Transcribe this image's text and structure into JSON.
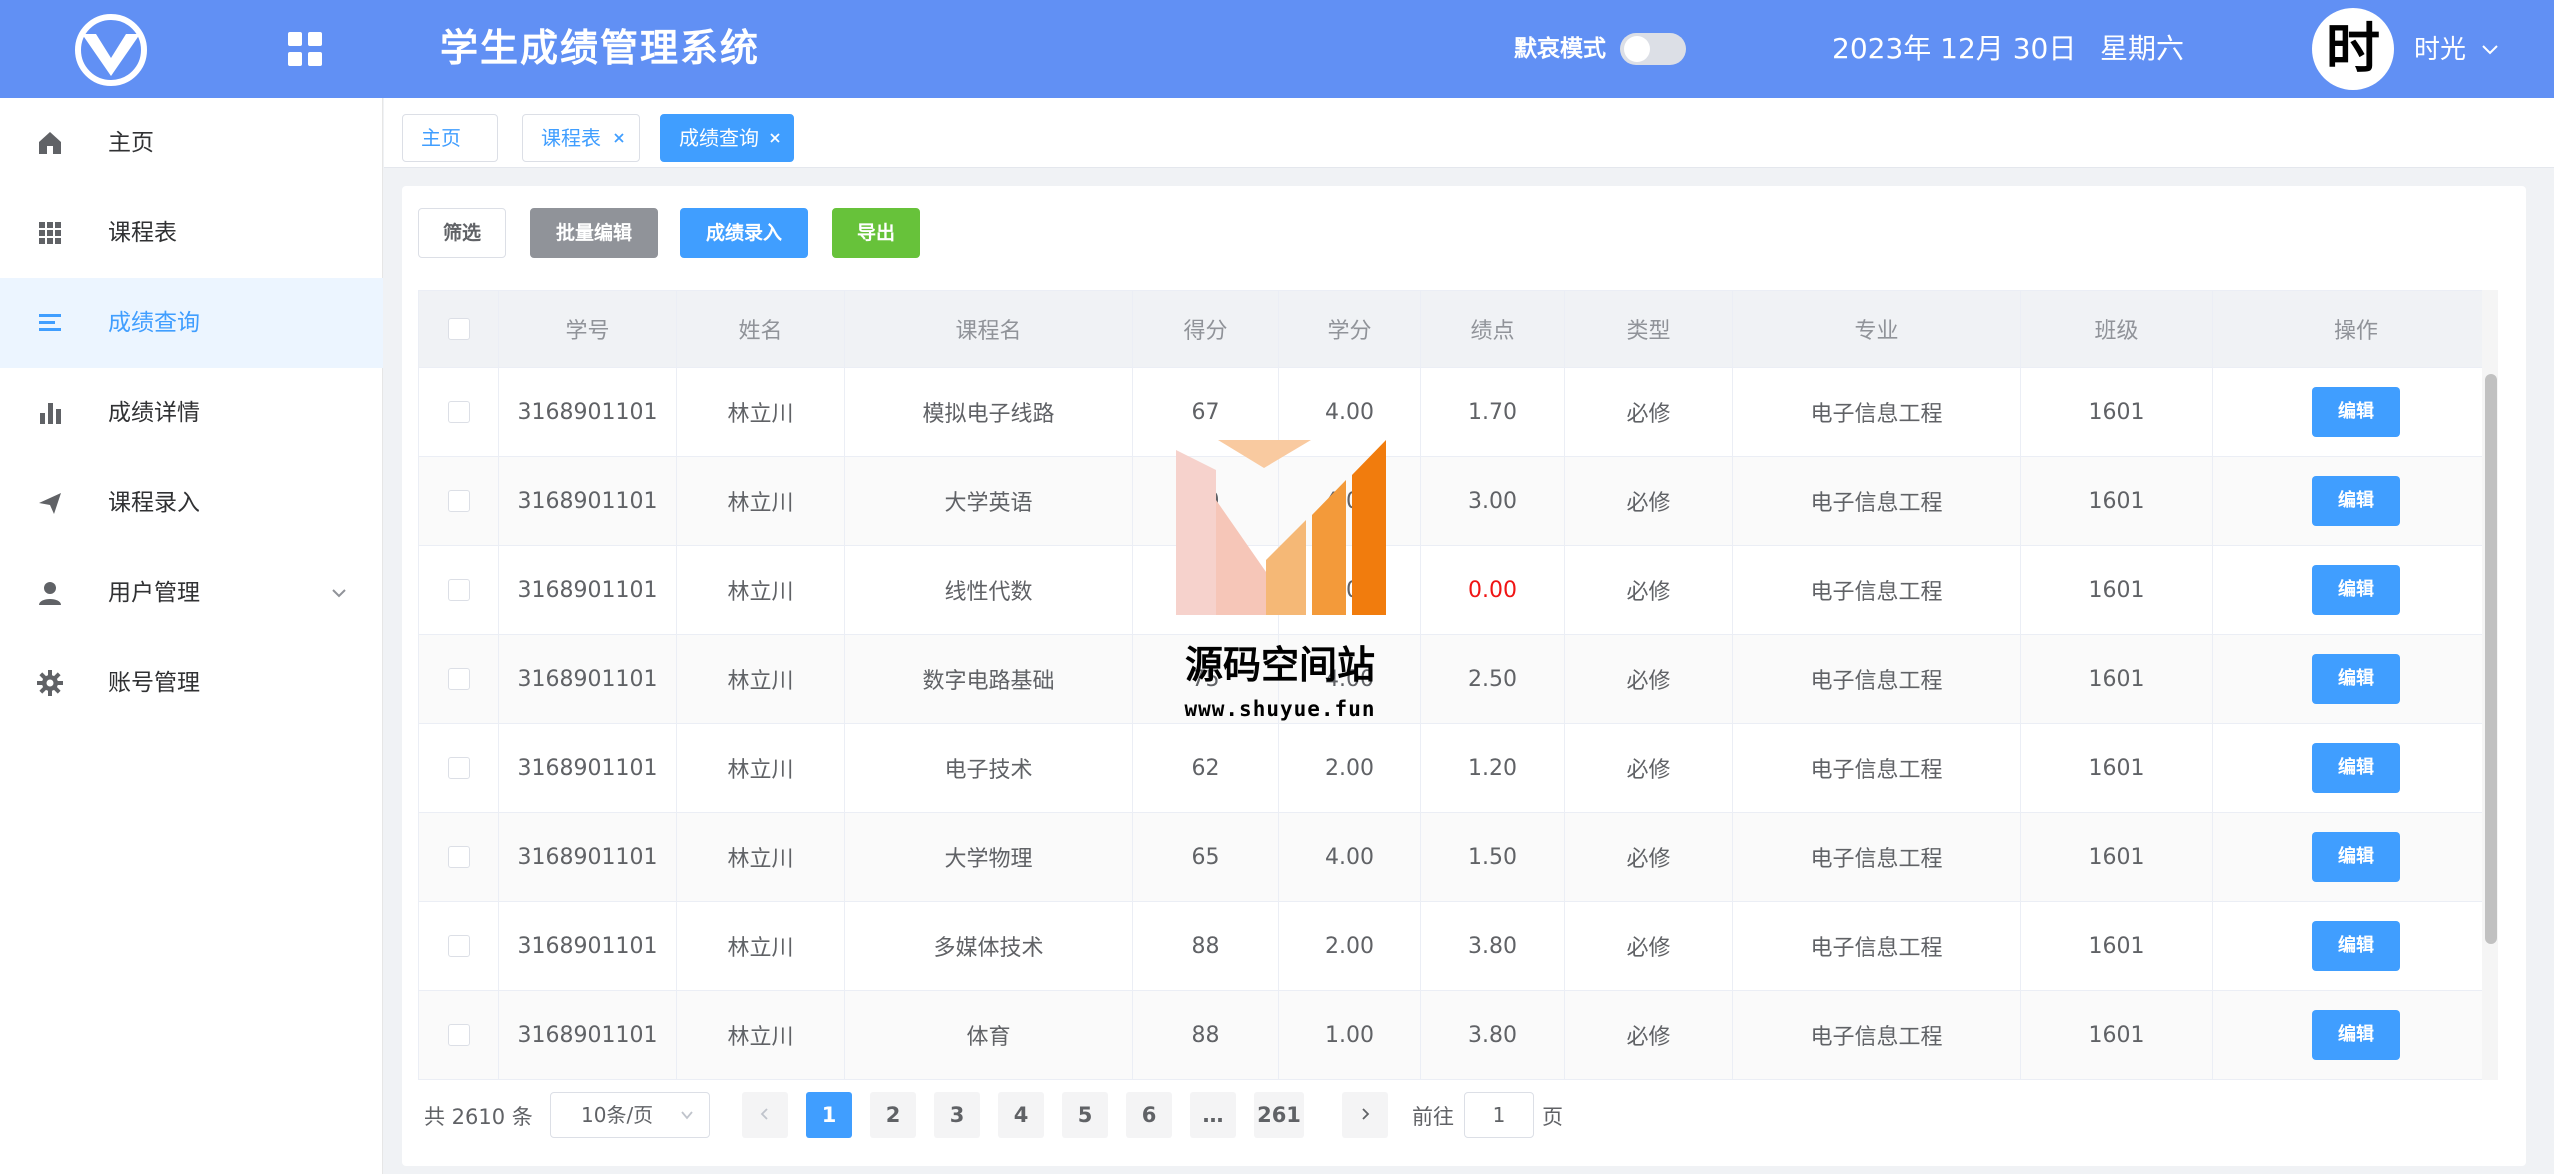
{
  "header": {
    "title": "学生成绩管理系统",
    "dark_mode_label": "默哀模式",
    "dark_mode_on": false,
    "date": "2023年 12月 30日",
    "weekday": "星期六",
    "avatar_text": "时",
    "username": "时光",
    "colors": {
      "bar": "#6190f4"
    }
  },
  "sidebar": {
    "items": [
      {
        "label": "主页",
        "icon": "home-icon"
      },
      {
        "label": "课程表",
        "icon": "grid-icon"
      },
      {
        "label": "成绩查询",
        "icon": "list-icon",
        "active": true
      },
      {
        "label": "成绩详情",
        "icon": "bar-chart-icon"
      },
      {
        "label": "课程录入",
        "icon": "send-icon"
      },
      {
        "label": "用户管理",
        "icon": "user-icon",
        "has_children": true
      },
      {
        "label": "账号管理",
        "icon": "gear-icon"
      }
    ]
  },
  "tabs": [
    {
      "label": "主页",
      "closable": false,
      "active": false
    },
    {
      "label": "课程表",
      "closable": true,
      "active": false
    },
    {
      "label": "成绩查询",
      "closable": true,
      "active": true
    }
  ],
  "toolbar": {
    "filter": "筛选",
    "batch_edit": "批量编辑",
    "grade_entry": "成绩录入",
    "export": "导出"
  },
  "table": {
    "columns": [
      "学号",
      "姓名",
      "课程名",
      "得分",
      "学分",
      "绩点",
      "类型",
      "专业",
      "班级",
      "操作"
    ],
    "edit_label": "编辑",
    "rows": [
      {
        "id": "3168901101",
        "name": "林立川",
        "course": "模拟电子线路",
        "score": "67",
        "credit": "4.00",
        "gpa": "1.70",
        "type": "必修",
        "major": "电子信息工程",
        "class": "1601"
      },
      {
        "id": "3168901101",
        "name": "林立川",
        "course": "大学英语",
        "score": "80",
        "credit": "4.00",
        "gpa": "3.00",
        "type": "必修",
        "major": "电子信息工程",
        "class": "1601"
      },
      {
        "id": "3168901101",
        "name": "林立川",
        "course": "线性代数",
        "score": "43",
        "credit": "4.00",
        "gpa": "0.00",
        "type": "必修",
        "major": "电子信息工程",
        "class": "1601",
        "failed": true
      },
      {
        "id": "3168901101",
        "name": "林立川",
        "course": "数字电路基础",
        "score": "75",
        "credit": "4.00",
        "gpa": "2.50",
        "type": "必修",
        "major": "电子信息工程",
        "class": "1601"
      },
      {
        "id": "3168901101",
        "name": "林立川",
        "course": "电子技术",
        "score": "62",
        "credit": "2.00",
        "gpa": "1.20",
        "type": "必修",
        "major": "电子信息工程",
        "class": "1601"
      },
      {
        "id": "3168901101",
        "name": "林立川",
        "course": "大学物理",
        "score": "65",
        "credit": "4.00",
        "gpa": "1.50",
        "type": "必修",
        "major": "电子信息工程",
        "class": "1601"
      },
      {
        "id": "3168901101",
        "name": "林立川",
        "course": "多媒体技术",
        "score": "88",
        "credit": "2.00",
        "gpa": "3.80",
        "type": "必修",
        "major": "电子信息工程",
        "class": "1601"
      },
      {
        "id": "3168901101",
        "name": "林立川",
        "course": "体育",
        "score": "88",
        "credit": "1.00",
        "gpa": "3.80",
        "type": "必修",
        "major": "电子信息工程",
        "class": "1601"
      }
    ]
  },
  "pagination": {
    "total": "共 2610 条",
    "page_size": "10条/页",
    "pages": [
      "1",
      "2",
      "3",
      "4",
      "5",
      "6",
      "…",
      "261"
    ],
    "current": "1",
    "goto_label": "前往",
    "goto_value": "1",
    "goto_suffix": "页"
  },
  "watermark": {
    "title": "源码空间站",
    "url": "www.shuyue.fun"
  }
}
